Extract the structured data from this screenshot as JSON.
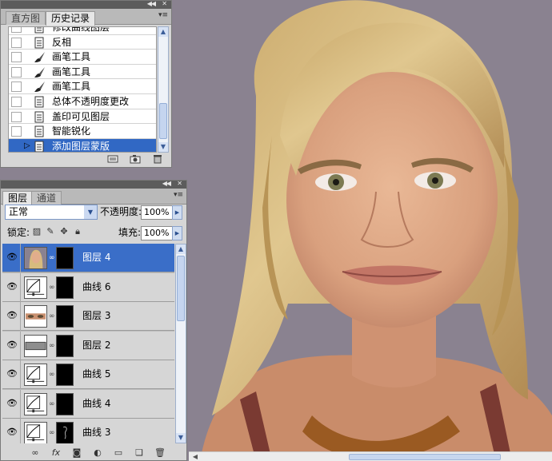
{
  "history_panel": {
    "tabs": [
      {
        "label": "直方图",
        "active": false
      },
      {
        "label": "历史记录",
        "active": true
      }
    ],
    "items": [
      {
        "label": "修改曲线图层",
        "icon": "document-icon",
        "selected": false
      },
      {
        "label": "反相",
        "icon": "document-icon",
        "selected": false
      },
      {
        "label": "画笔工具",
        "icon": "brush-icon",
        "selected": false
      },
      {
        "label": "画笔工具",
        "icon": "brush-icon",
        "selected": false
      },
      {
        "label": "画笔工具",
        "icon": "brush-icon",
        "selected": false
      },
      {
        "label": "总体不透明度更改",
        "icon": "document-icon",
        "selected": false
      },
      {
        "label": "盖印可见图层",
        "icon": "document-icon",
        "selected": false
      },
      {
        "label": "智能锐化",
        "icon": "document-icon",
        "selected": false
      },
      {
        "label": "添加图层蒙版",
        "icon": "document-icon",
        "selected": true
      }
    ]
  },
  "layers_panel": {
    "tabs": [
      {
        "label": "图层",
        "active": true
      },
      {
        "label": "通道",
        "active": false
      }
    ],
    "blend_mode": "正常",
    "opacity_label": "不透明度:",
    "opacity_value": "100%",
    "lock_label": "锁定:",
    "fill_label": "填充:",
    "fill_value": "100%",
    "layers": [
      {
        "name": "图层 4",
        "type": "photo",
        "selected": true
      },
      {
        "name": "曲线 6",
        "type": "curves",
        "selected": false
      },
      {
        "name": "图层 3",
        "type": "eyes",
        "selected": false
      },
      {
        "name": "图层 2",
        "type": "gray",
        "selected": false
      },
      {
        "name": "曲线 5",
        "type": "curves",
        "selected": false
      },
      {
        "name": "曲线 4",
        "type": "curves",
        "selected": false
      },
      {
        "name": "曲线 3",
        "type": "curves",
        "selected": false
      }
    ]
  },
  "colors": {
    "selection": "#3168c4",
    "panel_bg": "#d6d6d6"
  }
}
